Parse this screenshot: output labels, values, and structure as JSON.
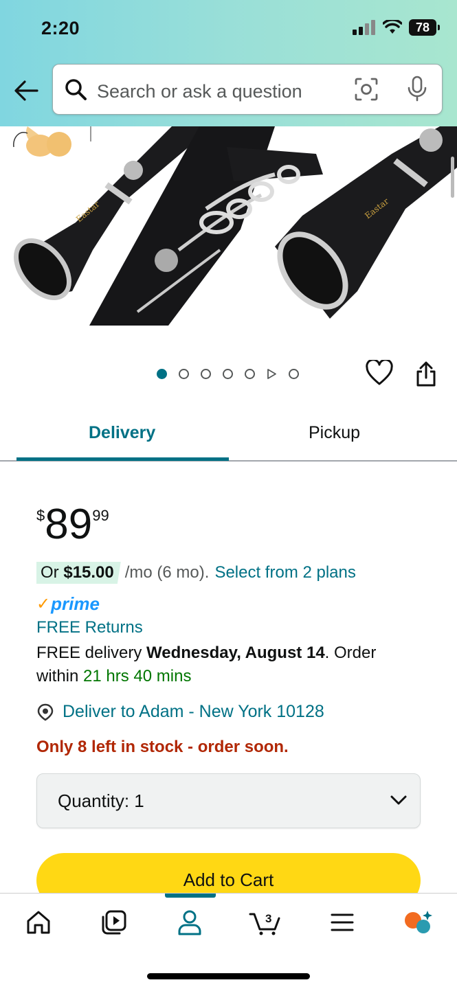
{
  "status_bar": {
    "time": "2:20",
    "battery": "78"
  },
  "search": {
    "placeholder": "Search or ask a question"
  },
  "carousel": {
    "total_dots": 7,
    "active_index": 0,
    "video_index": 5
  },
  "tabs": [
    {
      "label": "Delivery",
      "selected": true
    },
    {
      "label": "Pickup",
      "selected": false
    }
  ],
  "price": {
    "symbol": "$",
    "whole": "89",
    "fraction": "99"
  },
  "installment": {
    "prefix": "Or",
    "amount": "$15.00",
    "terms": "/mo (6 mo).",
    "link": "Select from 2 plans"
  },
  "prime": {
    "label": "prime"
  },
  "free_returns": "FREE Returns",
  "delivery": {
    "prefix": "FREE delivery",
    "date": "Wednesday, August 14",
    "suffix": ". Order within",
    "countdown": "21 hrs 40 mins"
  },
  "deliver_to": "Deliver to Adam - New York 10128",
  "stock_message": "Only 8 left in stock - order soon.",
  "quantity": {
    "label": "Quantity:",
    "value": "1"
  },
  "add_to_cart": "Add to Cart",
  "bottom_nav": {
    "cart_count": "3",
    "items": [
      "home-icon",
      "video-icon",
      "account-icon",
      "cart-icon",
      "menu-icon",
      "ai-assistant-icon"
    ],
    "active": "account-icon"
  },
  "colors": {
    "link": "#007185",
    "stock": "#b12704",
    "cart_button": "#ffd814",
    "prime": "#1a98ff"
  }
}
